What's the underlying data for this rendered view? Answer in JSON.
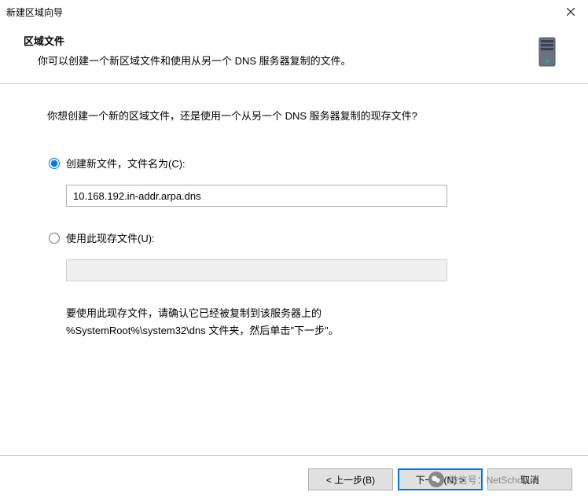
{
  "titlebar": {
    "title": "新建区域向导"
  },
  "header": {
    "title": "区域文件",
    "subtitle": "你可以创建一个新区域文件和使用从另一个 DNS 服务器复制的文件。"
  },
  "content": {
    "question": "你想创建一个新的区域文件，还是使用一个从另一个 DNS 服务器复制的现存文件?",
    "option_create": "创建新文件，文件名为(C):",
    "filename_value": "10.168.192.in-addr.arpa.dns",
    "option_existing": "使用此现存文件(U):",
    "existing_value": "",
    "note_line1": "要使用此现存文件，请确认它已经被复制到该服务器上的",
    "note_line2": "%SystemRoot%\\system32\\dns 文件夹，然后单击\"下一步\"。"
  },
  "buttons": {
    "back": "< 上一步(B)",
    "next": "下一步(N) >",
    "cancel": "取消"
  },
  "watermark": {
    "text": "微信号：NetScholar"
  }
}
